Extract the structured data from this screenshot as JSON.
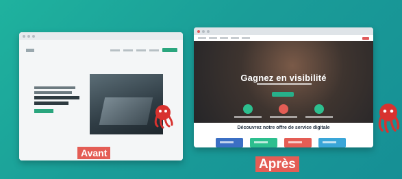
{
  "before": {
    "label": "Avant",
    "site": {
      "hero_text_lines": [
        "",
        "",
        ""
      ],
      "nav_links": 4
    }
  },
  "after": {
    "label": "Après",
    "site": {
      "hero_title": "Gagnez en visibilité",
      "section_heading": "Découvrez notre offre de service digitale"
    }
  },
  "colors": {
    "background": "#1a9d98",
    "label_bg": "#e45d55",
    "accent_green": "#27b08a",
    "mascot_red": "#d8322f"
  },
  "icons": {
    "mascot": "red-octopus-mascot-icon"
  }
}
